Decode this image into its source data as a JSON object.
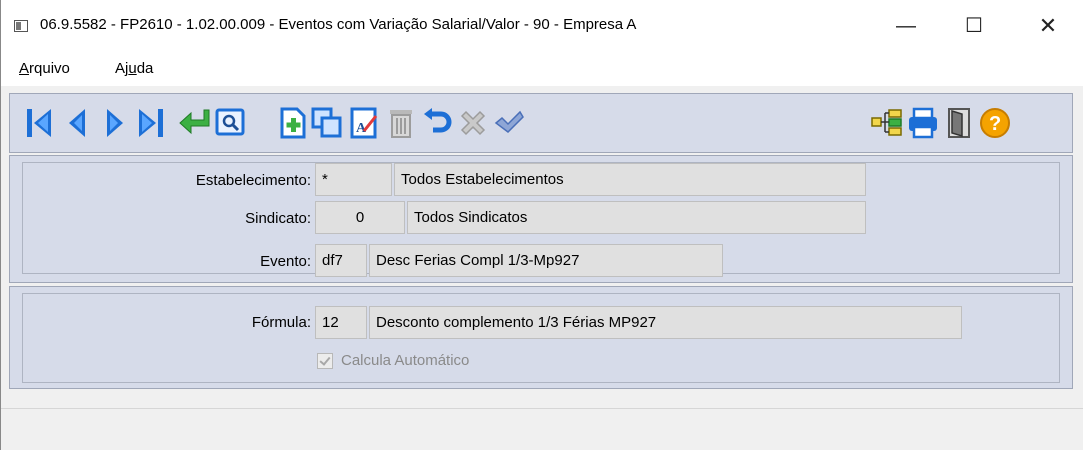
{
  "window": {
    "title": "06.9.5582 - FP2610 - 1.02.00.009 - Eventos com Variação Salarial/Valor - 90 - Empresa A",
    "minimize_symbol": "—",
    "maximize_symbol": "☐",
    "close_symbol": "✕"
  },
  "menu": {
    "arquivo": {
      "pre": "",
      "accel": "A",
      "post": "rquivo"
    },
    "ajuda": {
      "pre": "Aj",
      "accel": "u",
      "post": "da"
    }
  },
  "toolbar": {
    "icons": [
      "first-record-icon",
      "previous-record-icon",
      "next-record-icon",
      "last-record-icon",
      "return-icon",
      "search-icon",
      "new-record-icon",
      "copy-icon",
      "edit-icon",
      "delete-icon",
      "undo-icon",
      "cancel-icon",
      "confirm-icon",
      "tree-icon",
      "print-icon",
      "exit-icon",
      "help-icon"
    ],
    "help_symbol": "?"
  },
  "form": {
    "estabelecimento": {
      "label": "Estabelecimento:",
      "code": "*",
      "description": "Todos Estabelecimentos"
    },
    "sindicato": {
      "label": "Sindicato:",
      "code": "0",
      "description": "Todos Sindicatos"
    },
    "evento": {
      "label": "Evento:",
      "code": "df7",
      "description": "Desc  Ferias Compl 1/3-Mp927"
    },
    "formula": {
      "label": "Fórmula:",
      "code": "12",
      "description": "Desconto complemento 1/3 Férias MP927"
    },
    "calcula_automatico": {
      "label": "Calcula Automático",
      "checked": true,
      "enabled": false
    }
  },
  "colors": {
    "nav_blue": "#1d6fd6",
    "accent_green": "#3cb043",
    "help_orange": "#f5a300",
    "panel_bg": "#d6dbe9"
  }
}
